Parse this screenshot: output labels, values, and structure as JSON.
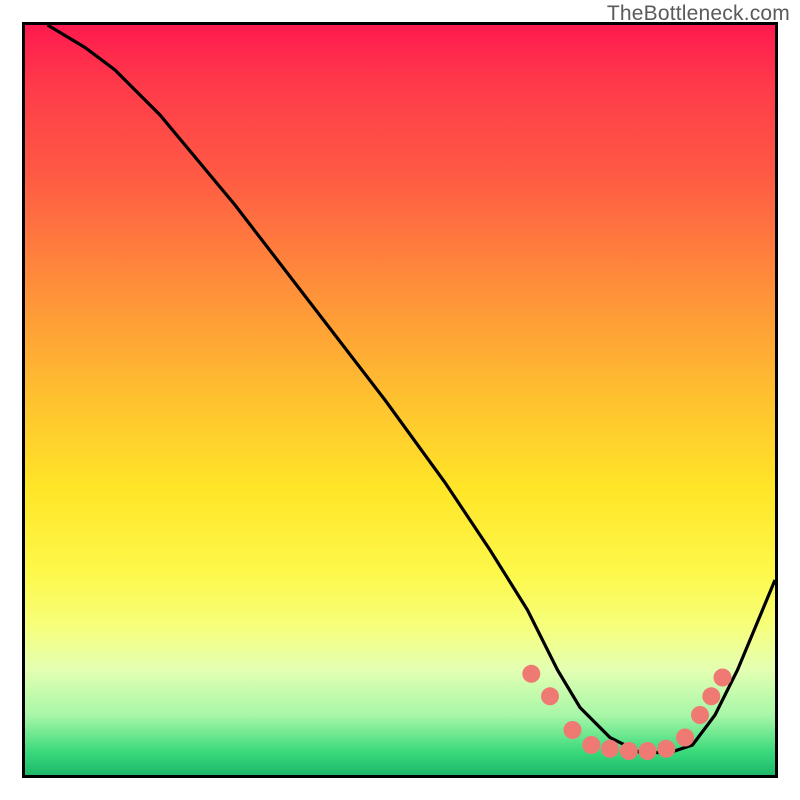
{
  "watermark": "TheBottleneck.com",
  "chart_data": {
    "type": "line",
    "title": "",
    "xlabel": "",
    "ylabel": "",
    "xlim": [
      0,
      100
    ],
    "ylim": [
      0,
      100
    ],
    "grid": false,
    "series": [
      {
        "name": "bottleneck-curve",
        "color": "#000000",
        "x": [
          3,
          8,
          12,
          18,
          28,
          38,
          48,
          56,
          62,
          67,
          71,
          74,
          78,
          82,
          86,
          89,
          92,
          95,
          100
        ],
        "y": [
          100,
          97,
          94,
          88,
          76,
          63,
          50,
          39,
          30,
          22,
          14,
          9,
          5,
          3,
          3,
          4,
          8,
          14,
          26
        ]
      }
    ],
    "markers": {
      "name": "highlight-dots",
      "color": "#ef7a74",
      "radius": 9,
      "points": [
        {
          "x": 67.5,
          "y": 13.5
        },
        {
          "x": 70.0,
          "y": 10.5
        },
        {
          "x": 73.0,
          "y": 6.0
        },
        {
          "x": 75.5,
          "y": 4.0
        },
        {
          "x": 78.0,
          "y": 3.5
        },
        {
          "x": 80.5,
          "y": 3.2
        },
        {
          "x": 83.0,
          "y": 3.2
        },
        {
          "x": 85.5,
          "y": 3.5
        },
        {
          "x": 88.0,
          "y": 5.0
        },
        {
          "x": 90.0,
          "y": 8.0
        },
        {
          "x": 91.5,
          "y": 10.5
        },
        {
          "x": 93.0,
          "y": 13.0
        }
      ]
    }
  }
}
